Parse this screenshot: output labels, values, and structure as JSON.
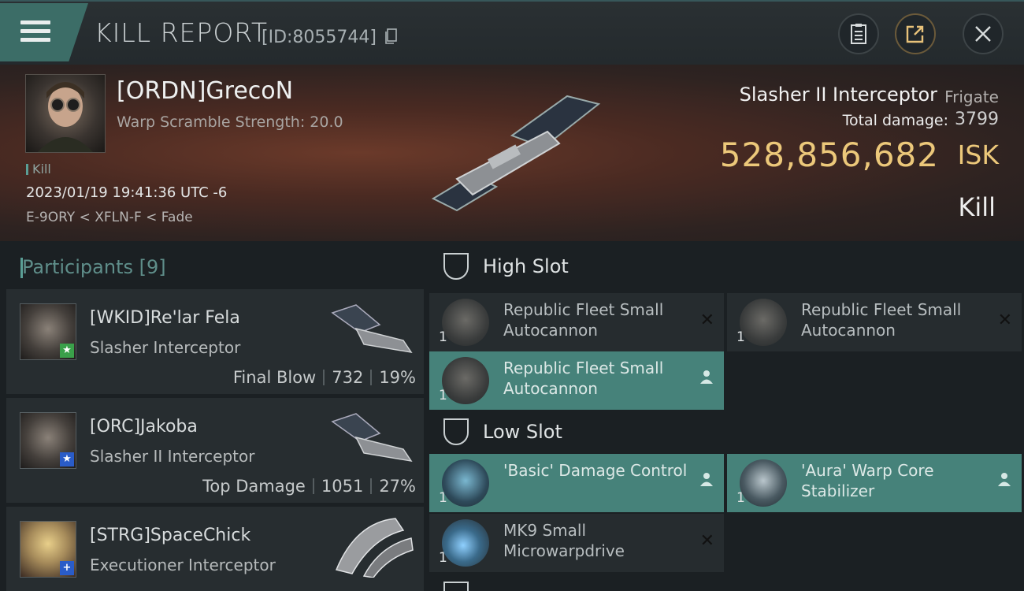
{
  "header": {
    "title": "KILL REPORT",
    "kill_id": "[ID:8055744]"
  },
  "victim": {
    "name": "[ORDN]GrecoN",
    "warp_scramble": "Warp Scramble Strength: 20.0",
    "tag": "Kill",
    "time": "2023/01/19 19:41:36 UTC -6",
    "location": "E-9ORY < XFLN-F < Fade",
    "ship_name": "Slasher II Interceptor",
    "ship_class": "Frigate",
    "total_damage_label": "Total damage:",
    "total_damage": "3799",
    "isk_value": "528,856,682",
    "isk_unit": "ISK",
    "result": "Kill"
  },
  "participants": {
    "title": "Participants [9]",
    "items": [
      {
        "name": "[WKID]Re'lar Fela",
        "ship": "Slasher Interceptor",
        "stat_label": "Final Blow",
        "damage": "732",
        "percent": "19%",
        "badge": "★",
        "badge_color": "#3aa04a"
      },
      {
        "name": "[ORC]Jakoba",
        "ship": "Slasher II Interceptor",
        "stat_label": "Top Damage",
        "damage": "1051",
        "percent": "27%",
        "badge": "★",
        "badge_color": "#2a5cc8"
      },
      {
        "name": "[STRG]SpaceChick",
        "ship": "Executioner Interceptor",
        "stat_label": "",
        "damage": "",
        "percent": "",
        "badge": "+",
        "badge_color": "#2a5cc8"
      }
    ]
  },
  "slots": {
    "high": {
      "label": "High Slot",
      "modules": [
        {
          "name": "Republic Fleet Small Autocannon",
          "qty": "1",
          "status": "destroyed"
        },
        {
          "name": "Republic Fleet Small Autocannon",
          "qty": "1",
          "status": "destroyed"
        },
        {
          "name": "Republic Fleet Small Autocannon",
          "qty": "1",
          "status": "dropped"
        }
      ]
    },
    "low": {
      "label": "Low Slot",
      "modules": [
        {
          "name": "'Basic' Damage Control",
          "qty": "1",
          "status": "dropped"
        },
        {
          "name": "'Aura' Warp Core Stabilizer",
          "qty": "1",
          "status": "dropped"
        },
        {
          "name": "MK9 Small Microwarpdrive",
          "qty": "1",
          "status": "destroyed"
        }
      ]
    }
  },
  "colors": {
    "accent": "#46827a",
    "isk": "#ecc87a"
  }
}
